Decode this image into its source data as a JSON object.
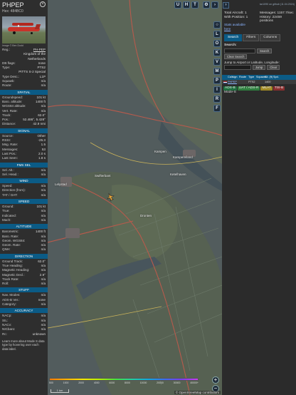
{
  "aircraft": {
    "callsign": "PHPEP",
    "hex_label": "Hex: 484BC0",
    "photo_credit": "Image © Ben Dodd",
    "close_icon": "close-icon"
  },
  "details": [
    {
      "k": "Reg.:",
      "v": "PH-PEP",
      "link": true
    },
    {
      "k": "",
      "v": "Kingdom of the Netherlands",
      "wrap": true
    },
    {
      "k": "DB flags:",
      "v": "none"
    },
    {
      "k": "Type:",
      "v": "PTS2"
    },
    {
      "k": "",
      "v": "PITTS S-2 Special"
    },
    {
      "k": "Type Desc.:",
      "v": "L1P"
    },
    {
      "k": "Squawk:",
      "v": "n/a"
    },
    {
      "k": "Route:",
      "v": "n/a"
    }
  ],
  "sections": [
    {
      "title": "SPATIAL",
      "rows": [
        [
          "Groundspeed:",
          "101 kt"
        ],
        [
          "Baro. altitude:",
          "1400 ft"
        ],
        [
          "WGS84 altitude:",
          "n/a"
        ],
        [
          "Vert. Rate:",
          "n/a"
        ],
        [
          "Track:",
          "62.0°"
        ],
        [
          "Pos.:",
          "52.486°, 5.428°"
        ],
        [
          "Distance:",
          "42.9 nmi"
        ]
      ]
    },
    {
      "title": "SIGNAL",
      "rows": [
        [
          "Source:",
          "Other"
        ],
        [
          "RSSI:",
          "-25.3"
        ],
        [
          "Msg. Rate:",
          "1.5"
        ],
        [
          "Messages:",
          "53"
        ],
        [
          "Last Pos.:",
          "2.0 s"
        ],
        [
          "Last Seen:",
          "1.8 s"
        ]
      ]
    },
    {
      "title": "FMS SEL",
      "rows": [
        [
          "Sel. Alt.:",
          "n/a"
        ],
        [
          "Sel. Head.:",
          "n/a"
        ]
      ]
    },
    {
      "title": "WIND",
      "rows": [
        [
          "Speed:",
          "n/a"
        ],
        [
          "Direction (from):",
          "n/a"
        ],
        [
          "TAT / OAT:",
          "n/a"
        ]
      ]
    },
    {
      "title": "SPEED",
      "rows": [
        [
          "Ground:",
          "101 kt"
        ],
        [
          "True:",
          "n/a"
        ],
        [
          "Indicated:",
          "n/a"
        ],
        [
          "Mach:",
          "n/a"
        ]
      ]
    },
    {
      "title": "ALTITUDE",
      "rows": [
        [
          "Barometric:",
          "1400 ft"
        ],
        [
          "Baro. Rate:",
          "n/a"
        ],
        [
          "Geom. WGS84:",
          "n/a"
        ],
        [
          "Geom. Rate:",
          "n/a"
        ],
        [
          "QNH:",
          "n/a"
        ]
      ]
    },
    {
      "title": "DIRECTION",
      "rows": [
        [
          "Ground Track:",
          "62.0°"
        ],
        [
          "True Heading:",
          "n/a"
        ],
        [
          "Magnetic Heading:",
          "n/a"
        ],
        [
          "Magnetic Decl.:",
          "2.9°"
        ],
        [
          "Track Rate:",
          "n/a"
        ],
        [
          "Roll:",
          "n/a"
        ]
      ]
    },
    {
      "title": "STUFF",
      "rows": [
        [
          "Nav. Modes:",
          "n/a"
        ],
        [
          "ADS-B Ver.:",
          "none"
        ],
        [
          "Category:",
          "n/a"
        ]
      ]
    },
    {
      "title": "ACCURACY",
      "rows": [
        [
          "NACp:",
          "n/a"
        ],
        [
          "SIL:",
          "n/a"
        ],
        [
          "NACv:",
          "n/a"
        ],
        [
          "NICbaro:",
          "n/a"
        ],
        [
          "Rc:",
          "unknown"
        ]
      ]
    }
  ],
  "footer_text": "Learn more about Mode S data type by hovering over each data label.",
  "map": {
    "top_buttons": [
      "U",
      "H",
      "T"
    ],
    "side_buttons": [
      "L",
      "O",
      "K",
      "V",
      "M",
      "P",
      "I",
      "R",
      "F"
    ],
    "places": [
      "Kampen",
      "Kampereiland",
      "Lelystad",
      "Swifterbant",
      "Dronten",
      "Ketelhaven",
      "Roggebotsluis",
      "Biddinghuizen"
    ],
    "scale_label": "1 km",
    "attribution": "© OpenStreetMap contributors",
    "alt_labels": [
      "500",
      "1000",
      "2000",
      "4000",
      "6000",
      "8000",
      "10000",
      "20000",
      "30000",
      "40000+"
    ],
    "zoom_in": "+",
    "zoom_out": "−"
  },
  "right": {
    "top_link": "tar1090 on github (11.04.2024)",
    "total_aircraft": "Total Aircraft: 1",
    "messages": "Messages: 1157.7/sec",
    "with_position": "With Position: 1",
    "history": "History: 22459 positions",
    "stats_available": "Stats available",
    "stats_link": "here",
    "tabs": [
      "Search",
      "Filters",
      "Columns"
    ],
    "search_label": "Search:",
    "search_button": "Search",
    "clear_search": "Clear Search",
    "jump_label": "Jump to Airport or Latitude, Longitude:",
    "jump_button": "Jump",
    "clear_button": "Clear",
    "columns": [
      "Callsign",
      "Route",
      "Type",
      "Squawk",
      "Alt. (ft)",
      "Spd."
    ],
    "table_rows": [
      [
        "PHPEP",
        "",
        "PTS2",
        "",
        "1400",
        ""
      ]
    ],
    "legend": [
      {
        "label": "ADS-B",
        "color": "#1f6f3f"
      },
      {
        "label": "UAT / ADS-R",
        "color": "#2f7f3f"
      },
      {
        "label": "MLAT",
        "color": "#a08a25"
      },
      {
        "label": "TIS-B",
        "color": "#8a2f2f"
      }
    ],
    "mode_s": "Mode-S"
  }
}
